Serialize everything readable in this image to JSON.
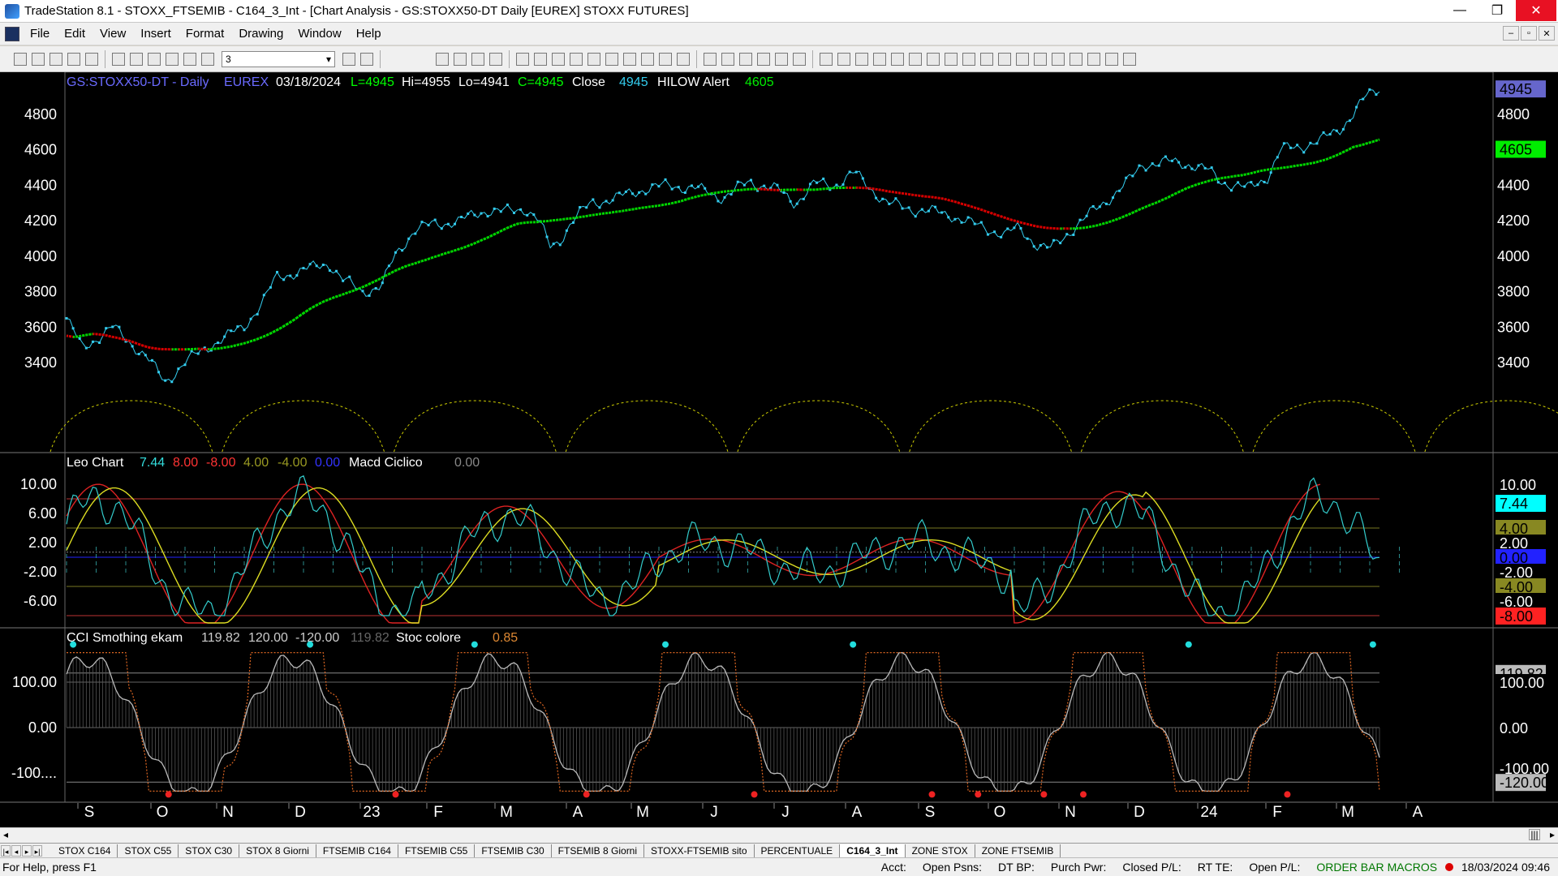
{
  "window": {
    "title": "TradeStation 8.1 - STOXX_FTSEMIB - C164_3_Int - [Chart Analysis - GS:STOXX50-DT  Daily  [EUREX] STOXX FUTURES]",
    "minimize": "—",
    "maximize": "❐",
    "close": "✕"
  },
  "menu": [
    "File",
    "Edit",
    "View",
    "Insert",
    "Format",
    "Drawing",
    "Window",
    "Help"
  ],
  "toolbar": {
    "combo_value": "3"
  },
  "price_header": {
    "symbol": "GS:STOXX50-DT - Daily",
    "exchange": "EUREX",
    "date": "03/18/2024",
    "last": "L=4945",
    "high": "Hi=4955",
    "low": "Lo=4941",
    "close": "C=4945",
    "close_label": "Close",
    "close_value": "4945",
    "alert_label": "HILOW Alert",
    "alert_value": "4605"
  },
  "price_axis": {
    "ticks": [
      "4800",
      "4600",
      "4400",
      "4200",
      "4000",
      "3800",
      "3600",
      "3400"
    ],
    "last_price_tag": "4945",
    "alert_tag": "4605"
  },
  "macd_header": {
    "name": "Leo Chart",
    "v1": "7.44",
    "v2": "8.00",
    "v3": "-8.00",
    "v4": "4.00",
    "v5": "-4.00",
    "v6": "0.00",
    "name2": "Macd Ciclico",
    "v7": "0.00"
  },
  "macd_axis": {
    "ticks": [
      "10.00",
      "6.00",
      "2.00",
      "-2.00",
      "-6.00"
    ],
    "tags": [
      "10.00",
      "7.44",
      "4.00",
      "2.00",
      "0.00",
      "-2.00",
      "-4.00",
      "-6.00",
      "-8.00"
    ]
  },
  "cci_header": {
    "name": "CCI Smothing ekam",
    "v1": "119.82",
    "v2": "120.00",
    "v3": "-120.00",
    "v4": "119.82",
    "name2": "Stoc colore",
    "v5": "0.85"
  },
  "cci_axis": {
    "ticks": [
      "100.00",
      "0.00",
      "-100...."
    ],
    "tags": [
      "119.82",
      "100.00",
      "0.00",
      "-100.00",
      "-120.00"
    ]
  },
  "time_axis": [
    "S",
    "O",
    "N",
    "D",
    "23",
    "F",
    "M",
    "A",
    "M",
    "J",
    "J",
    "A",
    "S",
    "O",
    "N",
    "D",
    "24",
    "F",
    "M",
    "A"
  ],
  "sheet_tabs": [
    "STOX C164",
    "STOX C55",
    "STOX  C30",
    "STOX  8 Giorni",
    "FTSEMIB C164",
    "FTSEMIB C55",
    "FTSEMIB C30",
    "FTSEMIB  8 Giorni",
    "STOXX-FTSEMIB sito",
    "PERCENTUALE",
    "C164_3_Int",
    "ZONE STOX",
    "ZONE FTSEMIB"
  ],
  "active_tab": "C164_3_Int",
  "status": {
    "help": "For Help, press F1",
    "acct": "Acct:",
    "open_psns": "Open Psns:",
    "dt_bp": "DT BP:",
    "purch_pwr": "Purch Pwr:",
    "closed_pl": "Closed P/L:",
    "rt_te": "RT TE:",
    "open_pl": "Open P/L:",
    "order_bar": "ORDER BAR",
    "macros": "MACROS",
    "datetime": "18/03/2024 09:46"
  },
  "colors": {
    "price": "#33ccee",
    "ma_up": "#00dd00",
    "ma_down": "#dd0000",
    "cycle": "#cccc00",
    "macd_fast": "#33cccc",
    "macd_red": "#dd2222",
    "macd_yellow": "#dddd22",
    "cci_line": "#bbbbbb",
    "stoc": "#dd6622"
  }
}
